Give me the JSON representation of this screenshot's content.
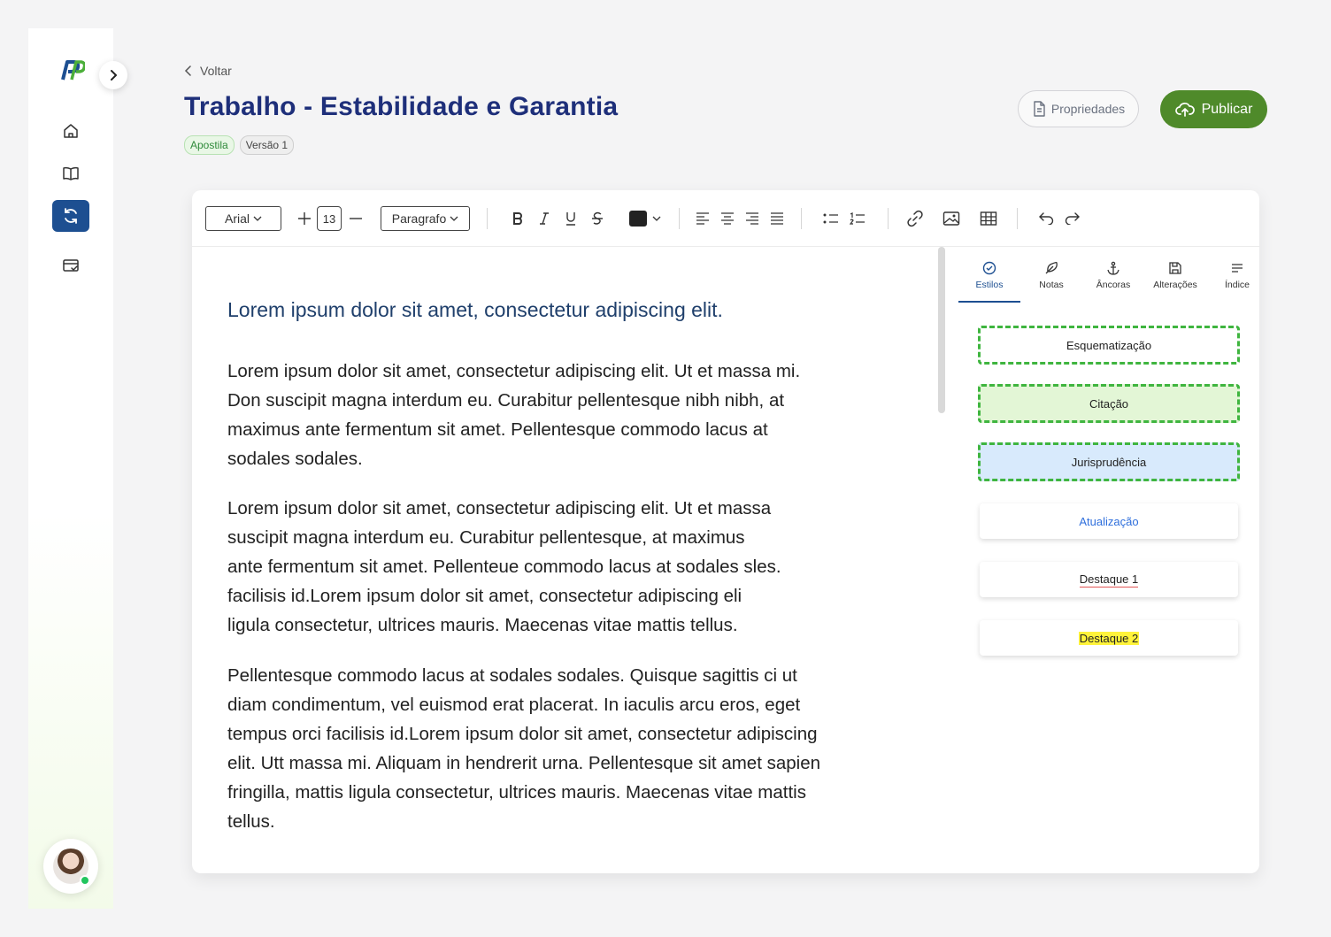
{
  "colors": {
    "primary": "#1d4f91",
    "title": "#1e2f7a",
    "publish": "#4f8a2a",
    "dashed_green": "#3fb53f",
    "link_blue": "#2f6fdc",
    "highlight_yellow": "#fff33b"
  },
  "sidebar": {
    "logo_text": "PP",
    "items": [
      {
        "icon": "home-icon"
      },
      {
        "icon": "book-icon"
      },
      {
        "icon": "sync-icon",
        "active": true
      },
      {
        "icon": "card-check-icon"
      }
    ]
  },
  "header": {
    "back_label": "Voltar",
    "title": "Trabalho - Estabilidade e Garantia",
    "badges": [
      "Apostila",
      "Versão 1"
    ],
    "properties_label": "Propriedades",
    "publish_label": "Publicar"
  },
  "toolbar": {
    "font": "Arial",
    "font_size": "13",
    "paragraph_style": "Paragrafo",
    "text_color": "#222222"
  },
  "document": {
    "heading": "Lorem ipsum dolor sit amet, consectetur adipiscing elit.",
    "paragraphs": [
      "Lorem ipsum dolor sit amet, consectetur adipiscing elit. Ut et massa mi.\nDon suscipit magna interdum eu. Curabitur pellentesque nibh nibh, at\nmaximus ante fermentum sit amet. Pellentesque commodo lacus at\nsodales sodales.",
      "Lorem ipsum dolor sit amet, consectetur adipiscing elit. Ut et massa\nsuscipit magna interdum eu. Curabitur pellentesque, at maximus\nante fermentum sit amet. Pellenteue commodo lacus at sodales sles.\nfacilisis id.Lorem ipsum dolor sit amet, consectetur adipiscing eli\nligula consectetur, ultrices mauris. Maecenas vitae mattis tellus.",
      "Pellentesque commodo lacus at sodales sodales. Quisque sagittis ci ut\ndiam condimentum, vel euismod erat placerat. In iaculis arcu eros, eget\ntempus orci facilisis id.Lorem ipsum dolor sit amet, consectetur adipiscing\nelit. Utt massa mi. Aliquam in hendrerit urna. Pellentesque sit amet sapien\nfringilla, mattis ligula consectetur, ultrices mauris. Maecenas vitae mattis\ntellus."
    ]
  },
  "panel": {
    "tabs": [
      {
        "label": "Estilos",
        "icon": "check-circle-icon",
        "active": true
      },
      {
        "label": "Notas",
        "icon": "feather-icon"
      },
      {
        "label": "Âncoras",
        "icon": "anchor-icon"
      },
      {
        "label": "Alterações",
        "icon": "save-icon"
      },
      {
        "label": "Índice",
        "icon": "list-icon"
      }
    ],
    "styles": [
      "Esquematização",
      "Citação",
      "Jurisprudência",
      "Atualização",
      "Destaque 1",
      "Destaque 2"
    ]
  }
}
